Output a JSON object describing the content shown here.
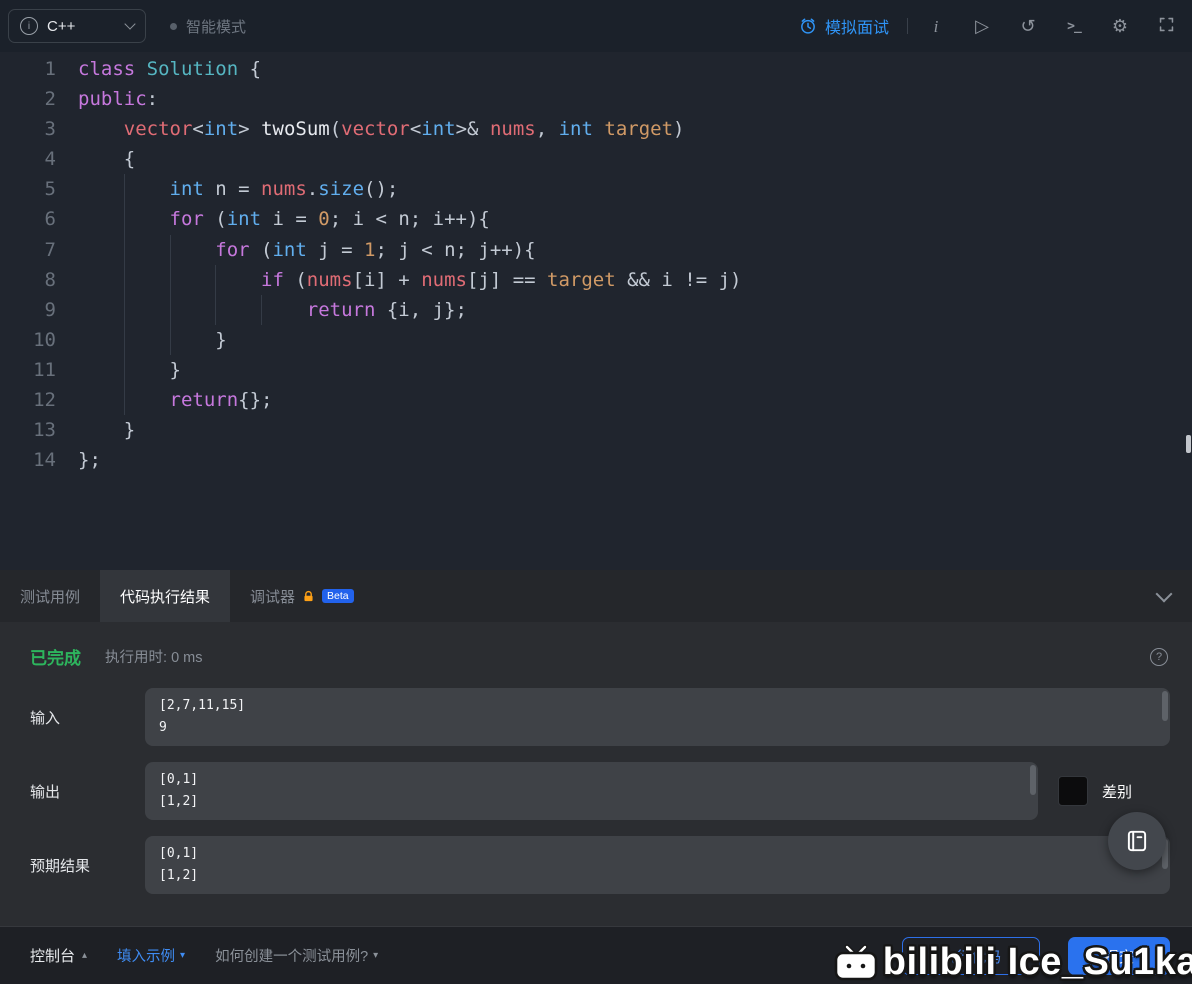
{
  "topbar": {
    "language": "C++",
    "mode": "智能模式",
    "mock_interview": "模拟面试"
  },
  "icons": {
    "info": "i",
    "play": "▷",
    "reset": "↺",
    "terminal": ">_",
    "gear": "⚙",
    "question": "?",
    "caret_up": "▴",
    "caret_down": "▾"
  },
  "editor": {
    "lines": [
      {
        "num": 1,
        "indent": 0,
        "tokens": [
          [
            "class",
            "k"
          ],
          [
            " ",
            "d"
          ],
          [
            "Solution",
            "c"
          ],
          [
            " {",
            "d"
          ]
        ]
      },
      {
        "num": 2,
        "indent": 0,
        "tokens": [
          [
            "public",
            "k"
          ],
          [
            ":",
            "d"
          ]
        ]
      },
      {
        "num": 3,
        "indent": 1,
        "tokens": [
          [
            "vector",
            "r"
          ],
          [
            "<",
            "d"
          ],
          [
            "int",
            "t"
          ],
          [
            ">",
            "d"
          ],
          [
            " ",
            "d"
          ],
          [
            "twoSum",
            "w"
          ],
          [
            "(",
            "d"
          ],
          [
            "vector",
            "r"
          ],
          [
            "<",
            "d"
          ],
          [
            "int",
            "t"
          ],
          [
            ">&",
            "d"
          ],
          [
            " ",
            "d"
          ],
          [
            "nums",
            "r"
          ],
          [
            ", ",
            "d"
          ],
          [
            "int",
            "t"
          ],
          [
            " ",
            "d"
          ],
          [
            "target",
            "o"
          ],
          [
            ")",
            "d"
          ]
        ]
      },
      {
        "num": 4,
        "indent": 1,
        "tokens": [
          [
            "{",
            "d"
          ]
        ]
      },
      {
        "num": 5,
        "indent": 2,
        "tokens": [
          [
            "int",
            "t"
          ],
          [
            " n = ",
            "d"
          ],
          [
            "nums",
            "r"
          ],
          [
            ".",
            "d"
          ],
          [
            "size",
            "t"
          ],
          [
            "();",
            "d"
          ]
        ]
      },
      {
        "num": 6,
        "indent": 2,
        "tokens": [
          [
            "for",
            "k"
          ],
          [
            " (",
            "d"
          ],
          [
            "int",
            "t"
          ],
          [
            " i = ",
            "d"
          ],
          [
            "0",
            "o"
          ],
          [
            "; i < n; i++){",
            "d"
          ]
        ]
      },
      {
        "num": 7,
        "indent": 3,
        "tokens": [
          [
            "for",
            "k"
          ],
          [
            " (",
            "d"
          ],
          [
            "int",
            "t"
          ],
          [
            " j = ",
            "d"
          ],
          [
            "1",
            "o"
          ],
          [
            "; j < n; j++){",
            "d"
          ]
        ]
      },
      {
        "num": 8,
        "indent": 4,
        "tokens": [
          [
            "if",
            "k"
          ],
          [
            " (",
            "d"
          ],
          [
            "nums",
            "r"
          ],
          [
            "[i] + ",
            "d"
          ],
          [
            "nums",
            "r"
          ],
          [
            "[j] == ",
            "d"
          ],
          [
            "target",
            "o"
          ],
          [
            " && i != j)",
            "d"
          ]
        ]
      },
      {
        "num": 9,
        "indent": 5,
        "tokens": [
          [
            "return",
            "k"
          ],
          [
            " {i, j};",
            "d"
          ]
        ]
      },
      {
        "num": 10,
        "indent": 3,
        "tokens": [
          [
            "}",
            "d"
          ]
        ]
      },
      {
        "num": 11,
        "indent": 2,
        "tokens": [
          [
            "}",
            "d"
          ]
        ]
      },
      {
        "num": 12,
        "indent": 2,
        "tokens": [
          [
            "return",
            "k"
          ],
          [
            "{};",
            "d"
          ]
        ]
      },
      {
        "num": 13,
        "indent": 1,
        "tokens": [
          [
            "}",
            "d"
          ]
        ]
      },
      {
        "num": 14,
        "indent": 0,
        "tokens": [
          [
            "};",
            "d"
          ]
        ]
      }
    ]
  },
  "tabs": {
    "items": [
      {
        "name": "tab-testcase",
        "label": "测试用例",
        "active": false
      },
      {
        "name": "tab-run-result",
        "label": "代码执行结果",
        "active": true
      },
      {
        "name": "tab-debugger",
        "label": "调试器",
        "active": false,
        "locked": true,
        "badge": "Beta"
      }
    ]
  },
  "results": {
    "status": "已完成",
    "runtime_label": "执行用时:",
    "runtime_value": "0 ms",
    "rows": [
      {
        "label": "输入",
        "lines": [
          "[2,7,11,15]",
          "9"
        ]
      },
      {
        "label": "输出",
        "lines": [
          "[0,1]",
          "[1,2]"
        ],
        "diff_label": "差别"
      },
      {
        "label": "预期结果",
        "lines": [
          "[0,1]",
          "[1,2]"
        ]
      }
    ]
  },
  "footer": {
    "console": "控制台",
    "fill_example": "填入示例",
    "help": "如何创建一个测试用例?",
    "run": "执行代码",
    "submit": "提交"
  },
  "watermark": "bilibili Ice_Su1ka",
  "colors": {
    "accent_blue": "#2f94f6",
    "success_green": "#2db55d",
    "beta_badge": "#2262ec",
    "lock_orange": "#ffa116",
    "diff_swatch": "#0c0c0d"
  }
}
